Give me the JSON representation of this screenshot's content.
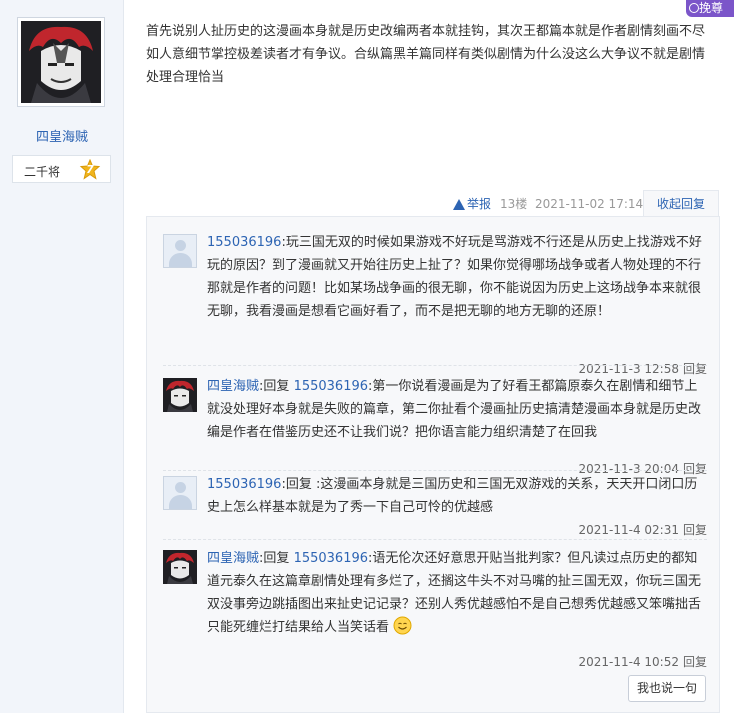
{
  "author": {
    "name": "四皇海贼",
    "rank_name": "二千将",
    "rank_level": "7"
  },
  "top_tag": {
    "label": "挽尊"
  },
  "post": {
    "content": "首先说别人扯历史的这漫画本身就是历史改编两者本就挂钩，其次王都篇本就是作者剧情刻画不尽如人意细节掌控极差读者才有争议。合纵篇黑羊篇同样有类似剧情为什么没这么大争议不就是剧情处理合理恰当",
    "report_label": "举报",
    "floor": "13楼",
    "time": "2021-11-02 17:14",
    "collapse_label": "收起回复"
  },
  "replies": [
    {
      "user": "155036196",
      "sep": ":",
      "has_target": false,
      "text": "玩三国无双的时候如果游戏不好玩是骂游戏不行还是从历史上找游戏不好玩的原因？到了漫画就又开始往历史上扯了？如果你觉得哪场战争或者人物处理的不行那就是作者的问题！比如某场战争画的很无聊，你不能说因为历史上这场战争本来就很无聊，我看漫画是想看它画好看了，而不是把无聊的地方无聊的还原！",
      "time": "2021-11-3 12:58",
      "reply_label": "回复"
    },
    {
      "user": "四皇海贼",
      "sep": ":",
      "has_target": true,
      "reply_word": "回复",
      "target": "155036196",
      "text": ":第一你说看漫画是为了好看王都篇原泰久在剧情和细节上就没处理好本身就是失败的篇章，第二你扯看个漫画扯历史搞清楚漫画本身就是历史改编是作者在借鉴历史还不让我们说？把你语言能力组织清楚了在回我",
      "time": "2021-11-3 20:04",
      "reply_label": "回复"
    },
    {
      "user": "155036196",
      "sep": ":",
      "has_target": false,
      "reply_word": "回复",
      "text": "回复 :这漫画本身就是三国历史和三国无双游戏的关系，天天开口闭口历史上怎么样基本就是为了秀一下自己可怜的优越感",
      "time": "2021-11-4 02:31",
      "reply_label": "回复"
    },
    {
      "user": "四皇海贼",
      "sep": ":",
      "has_target": true,
      "reply_word": "回复",
      "target": "155036196",
      "text": ":语无伦次还好意思开贴当批判家？但凡读过点历史的都知道元泰久在这篇章剧情处理有多烂了，还搁这牛头不对马嘴的扯三国无双，你玩三国无双没事旁边跳插图出来扯史记记录？还别人秀优越感怕不是自己想秀优越感又笨嘴拙舌只能死缠烂打结果给人当笑话看",
      "time": "2021-11-4 10:52",
      "reply_label": "回复"
    }
  ],
  "say_button": {
    "label": "我也说一句"
  }
}
